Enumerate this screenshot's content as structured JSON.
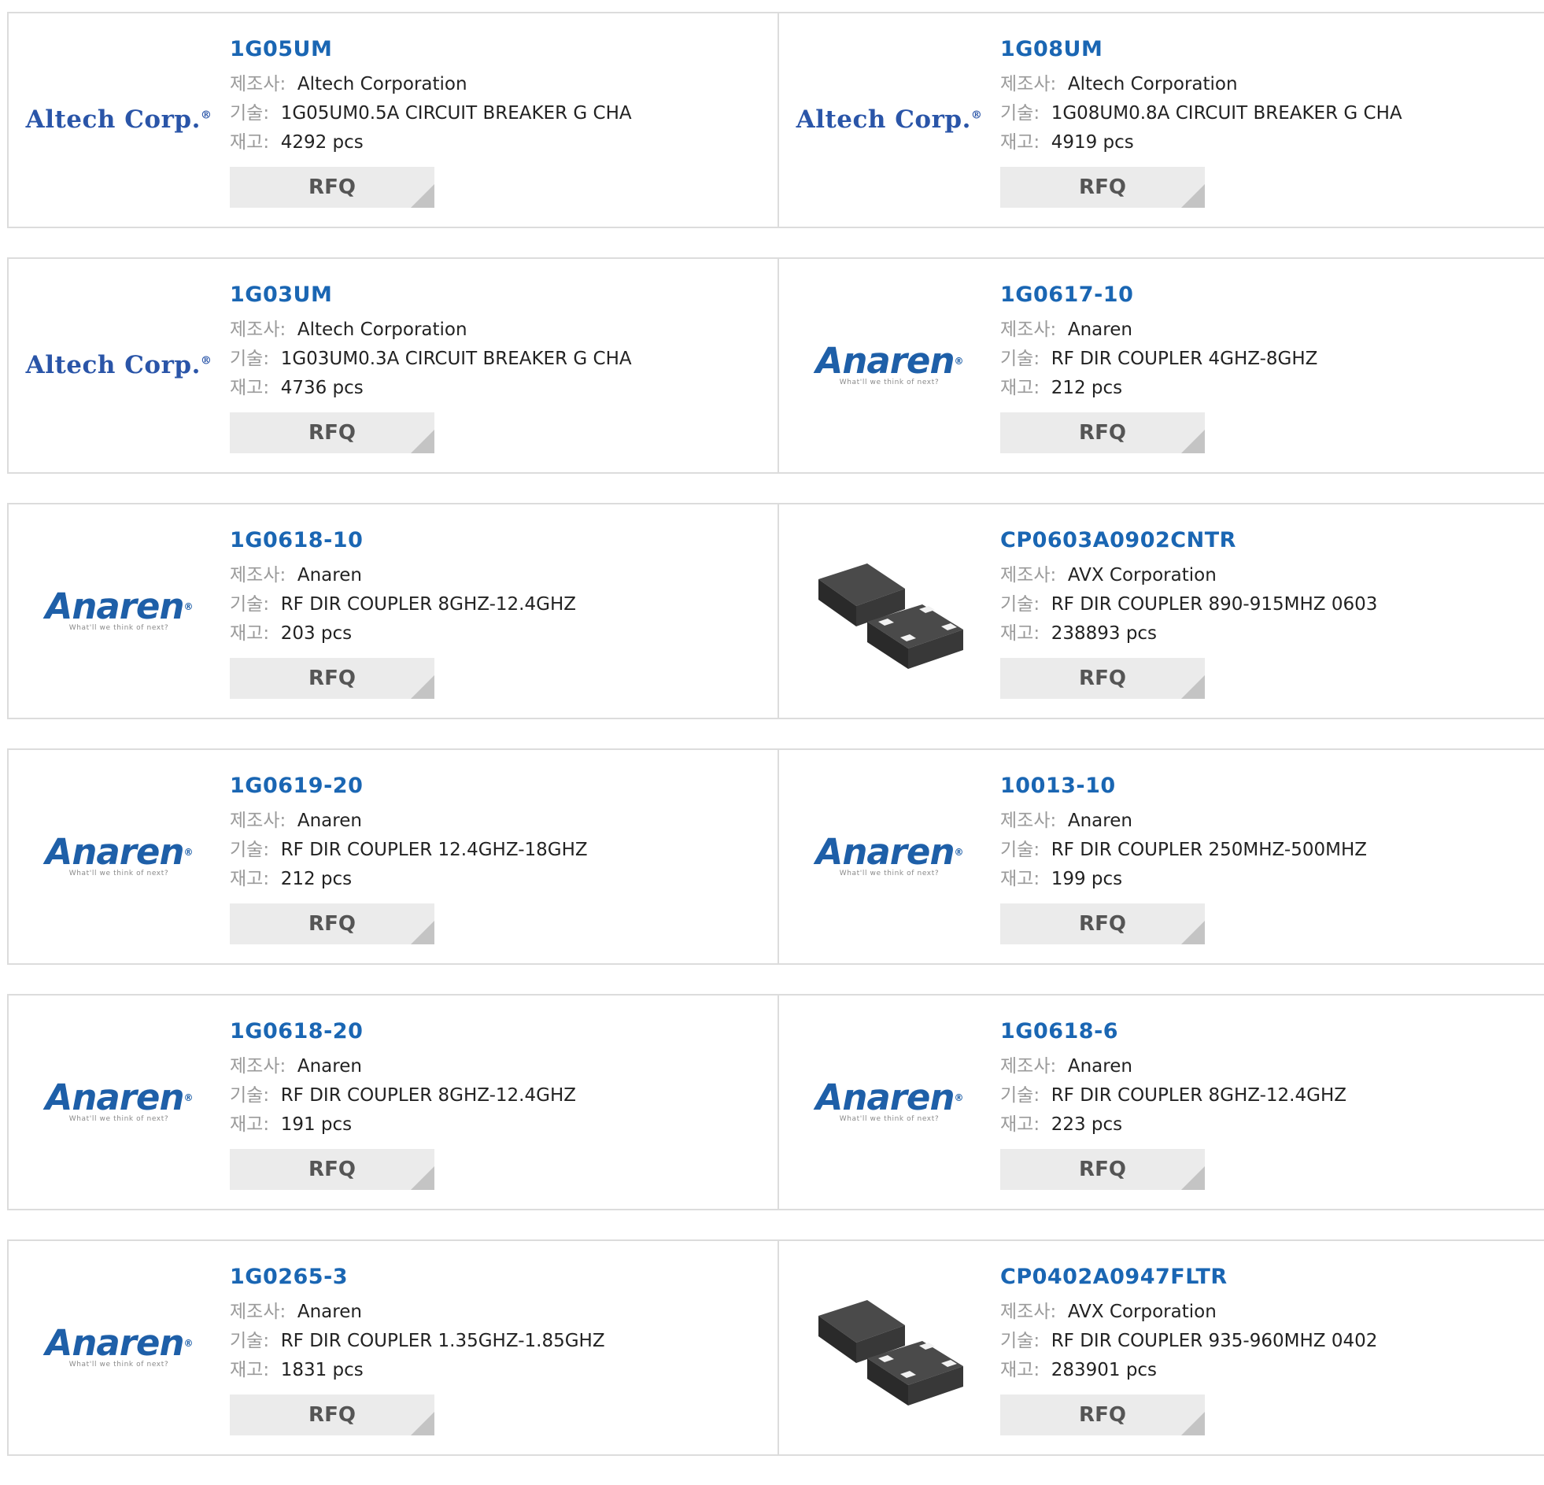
{
  "labels": {
    "manufacturer": "제조사:",
    "description": "기술:",
    "stock": "재고:"
  },
  "products": [
    {
      "part": "1G05UM",
      "manufacturer": "Altech Corporation",
      "description": "1G05UM0.5A CIRCUIT BREAKER G CHA",
      "stock": "4292 pcs",
      "rfq": "RFQ",
      "logo": "altech",
      "logo_text": "Altech Corp."
    },
    {
      "part": "1G08UM",
      "manufacturer": "Altech Corporation",
      "description": "1G08UM0.8A CIRCUIT BREAKER G CHA",
      "stock": "4919 pcs",
      "rfq": "RFQ",
      "logo": "altech",
      "logo_text": "Altech Corp."
    },
    {
      "part": "1G03UM",
      "manufacturer": "Altech Corporation",
      "description": "1G03UM0.3A CIRCUIT BREAKER G CHA",
      "stock": "4736 pcs",
      "rfq": "RFQ",
      "logo": "altech",
      "logo_text": "Altech Corp."
    },
    {
      "part": "1G0617-10",
      "manufacturer": "Anaren",
      "description": "RF DIR COUPLER 4GHZ-8GHZ",
      "stock": "212 pcs",
      "rfq": "RFQ",
      "logo": "anaren",
      "logo_text": "Anaren",
      "logo_tag": "What'll we think of next?"
    },
    {
      "part": "1G0618-10",
      "manufacturer": "Anaren",
      "description": "RF DIR COUPLER 8GHZ-12.4GHZ",
      "stock": "203 pcs",
      "rfq": "RFQ",
      "logo": "anaren",
      "logo_text": "Anaren",
      "logo_tag": "What'll we think of next?"
    },
    {
      "part": "CP0603A0902CNTR",
      "manufacturer": "AVX Corporation",
      "description": "RF DIR COUPLER 890-915MHZ 0603",
      "stock": "238893 pcs",
      "rfq": "RFQ",
      "logo": "chip"
    },
    {
      "part": "1G0619-20",
      "manufacturer": "Anaren",
      "description": "RF DIR COUPLER 12.4GHZ-18GHZ",
      "stock": "212 pcs",
      "rfq": "RFQ",
      "logo": "anaren",
      "logo_text": "Anaren",
      "logo_tag": "What'll we think of next?"
    },
    {
      "part": "10013-10",
      "manufacturer": "Anaren",
      "description": "RF DIR COUPLER 250MHZ-500MHZ",
      "stock": "199 pcs",
      "rfq": "RFQ",
      "logo": "anaren",
      "logo_text": "Anaren",
      "logo_tag": "What'll we think of next?"
    },
    {
      "part": "1G0618-20",
      "manufacturer": "Anaren",
      "description": "RF DIR COUPLER 8GHZ-12.4GHZ",
      "stock": "191 pcs",
      "rfq": "RFQ",
      "logo": "anaren",
      "logo_text": "Anaren",
      "logo_tag": "What'll we think of next?"
    },
    {
      "part": "1G0618-6",
      "manufacturer": "Anaren",
      "description": "RF DIR COUPLER 8GHZ-12.4GHZ",
      "stock": "223 pcs",
      "rfq": "RFQ",
      "logo": "anaren",
      "logo_text": "Anaren",
      "logo_tag": "What'll we think of next?"
    },
    {
      "part": "1G0265-3",
      "manufacturer": "Anaren",
      "description": "RF DIR COUPLER 1.35GHZ-1.85GHZ",
      "stock": "1831 pcs",
      "rfq": "RFQ",
      "logo": "anaren",
      "logo_text": "Anaren",
      "logo_tag": "What'll we think of next?"
    },
    {
      "part": "CP0402A0947FLTR",
      "manufacturer": "AVX Corporation",
      "description": "RF DIR COUPLER 935-960MHZ 0402",
      "stock": "283901 pcs",
      "rfq": "RFQ",
      "logo": "chip"
    }
  ],
  "colors": {
    "part_link": "#1a66b3",
    "label_gray": "#9a9a9a",
    "border": "#dcdcdc",
    "rfq_bg": "#ebebeb",
    "altech_blue": "#2a55a8",
    "anaren_blue": "#1e5fa8"
  }
}
